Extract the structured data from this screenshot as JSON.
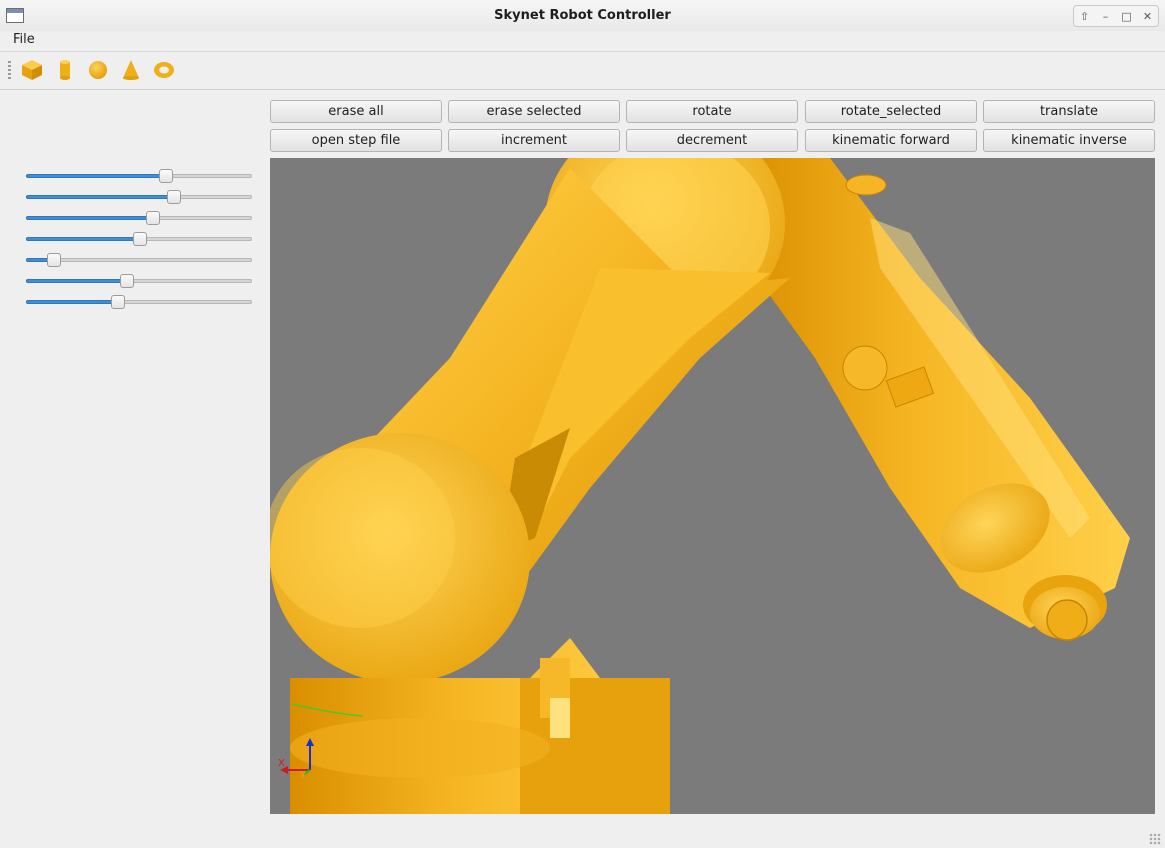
{
  "window": {
    "title": "Skynet Robot Controller",
    "controls": [
      "⇧",
      "–",
      "□",
      "✕"
    ]
  },
  "menu": {
    "file": "File"
  },
  "toolbar": {
    "tools": [
      "cube-icon",
      "cylinder-icon",
      "sphere-icon",
      "cone-icon",
      "torus-icon"
    ],
    "accent_color": "#f2b21e"
  },
  "sliders": [
    {
      "name": "joint-1",
      "value": 0.62
    },
    {
      "name": "joint-2",
      "value": 0.655
    },
    {
      "name": "joint-3",
      "value": 0.56
    },
    {
      "name": "joint-4",
      "value": 0.505
    },
    {
      "name": "joint-5",
      "value": 0.125
    },
    {
      "name": "joint-6",
      "value": 0.445
    },
    {
      "name": "joint-7",
      "value": 0.405
    }
  ],
  "buttons": {
    "erase_all": "erase all",
    "erase_selected": "erase selected",
    "rotate": "rotate",
    "rotate_selected": "rotate_selected",
    "translate": "translate",
    "open_step_file": "open step file",
    "increment": "increment",
    "decrement": "decrement",
    "kinematic_forward": "kinematic forward",
    "kinematic_inverse": "kinematic inverse"
  },
  "viewport": {
    "background": "#7b7b7b",
    "model_color": "#f5b422",
    "axis": {
      "z": "Z",
      "x": "X",
      "y": "Y"
    }
  }
}
